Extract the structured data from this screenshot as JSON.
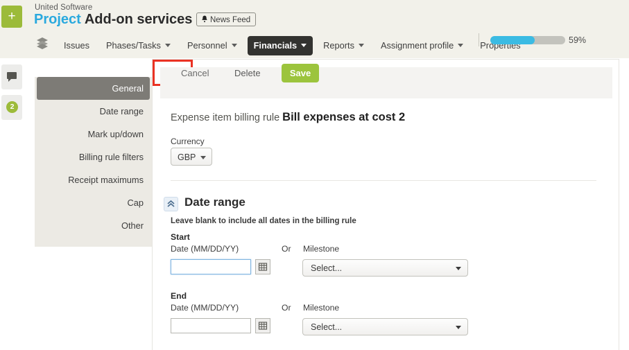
{
  "header": {
    "add_button_label": "+",
    "company": "United Software",
    "title_prefix": "Project",
    "title_name": "Add-on services",
    "sparkline_icon": "chart-icon",
    "news_feed_label": "News Feed",
    "news_feed_icon": "bell-icon"
  },
  "nav": {
    "layers_icon": "layers-icon",
    "items": [
      {
        "label": "Issues",
        "has_caret": false,
        "active": false
      },
      {
        "label": "Phases/Tasks",
        "has_caret": true,
        "active": false
      },
      {
        "label": "Personnel",
        "has_caret": true,
        "active": false
      },
      {
        "label": "Financials",
        "has_caret": true,
        "active": true
      },
      {
        "label": "Reports",
        "has_caret": true,
        "active": false
      },
      {
        "label": "Assignment profile",
        "has_caret": true,
        "active": false
      },
      {
        "label": "Properties",
        "has_caret": false,
        "active": false
      }
    ],
    "progress_percent": 59,
    "progress_label": "59%",
    "progress_color": "#3bbbe3"
  },
  "rail": {
    "comment_icon": "comment-bubble-icon",
    "badge_count": "2",
    "badge_color": "#9cbb3a"
  },
  "tabs": {
    "items": [
      {
        "label": "General",
        "active": true
      },
      {
        "label": "Date range",
        "active": false
      },
      {
        "label": "Mark up/down",
        "active": false
      },
      {
        "label": "Billing rule filters",
        "active": false
      },
      {
        "label": "Receipt maximums",
        "active": false
      },
      {
        "label": "Cap",
        "active": false
      },
      {
        "label": "Other",
        "active": false
      }
    ]
  },
  "toolbar": {
    "cancel_label": "Cancel",
    "delete_label": "Delete",
    "save_label": "Save",
    "save_color": "#9cc43d",
    "highlight_color": "#ea3223"
  },
  "form": {
    "subtitle_prefix": "Expense item billing rule",
    "subtitle_name": "Bill expenses at cost 2",
    "currency_label": "Currency",
    "currency_value": "GBP"
  },
  "date_range": {
    "collapse_icon": "chevron-double-up-icon",
    "section_title": "Date range",
    "hint": "Leave blank to include all dates in the billing rule",
    "or_label": "Or",
    "start": {
      "group_title": "Start",
      "date_label": "Date (MM/DD/YY)",
      "date_value": "",
      "calendar_icon": "calendar-icon",
      "milestone_label": "Milestone",
      "milestone_value": "Select..."
    },
    "end": {
      "group_title": "End",
      "date_label": "Date (MM/DD/YY)",
      "date_value": "",
      "calendar_icon": "calendar-icon",
      "milestone_label": "Milestone",
      "milestone_value": "Select..."
    }
  }
}
